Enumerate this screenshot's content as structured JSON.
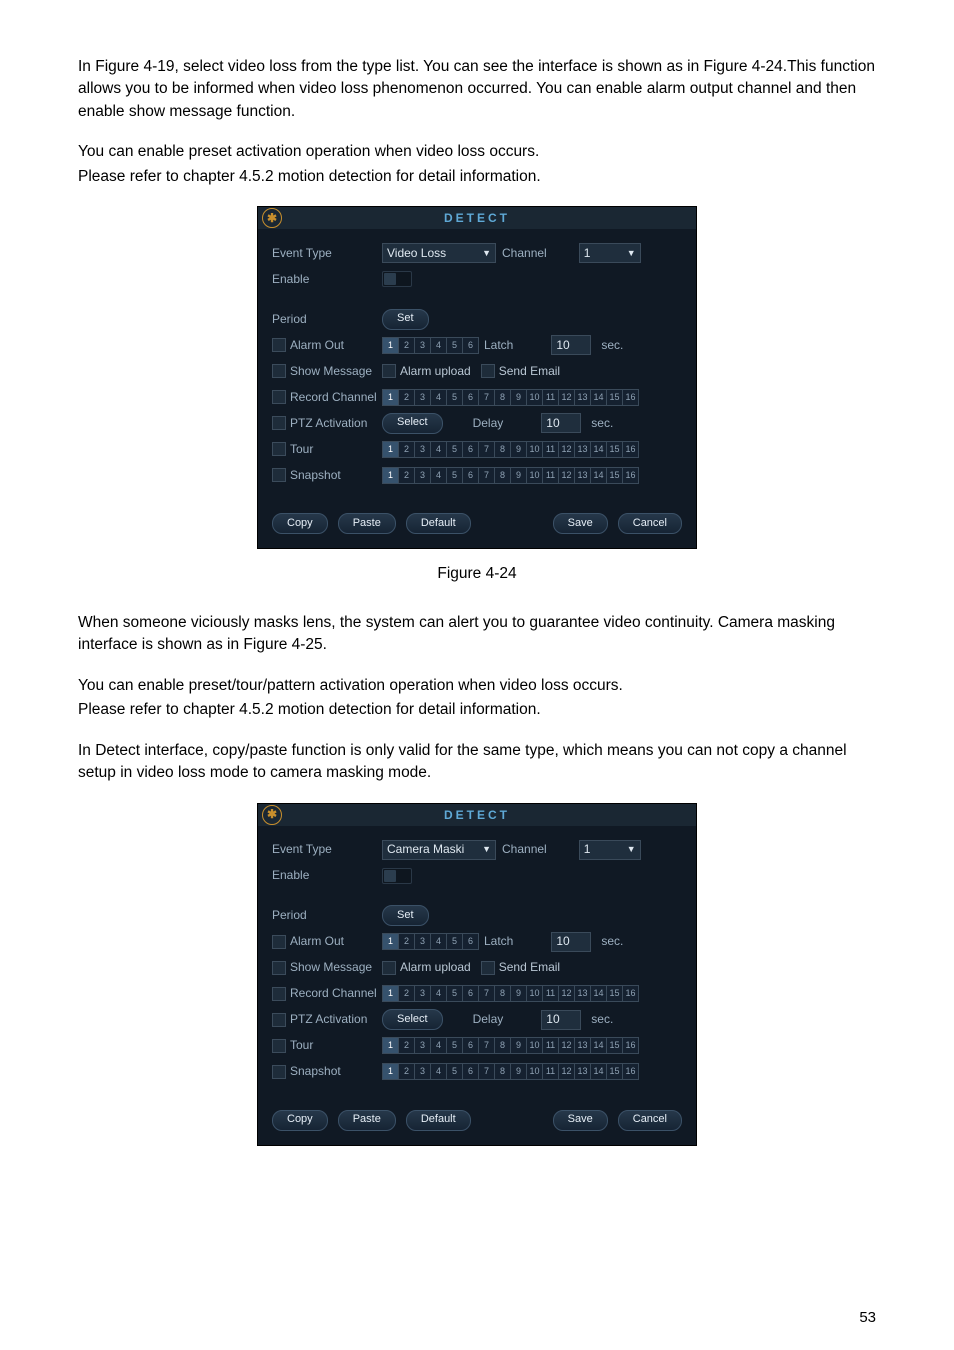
{
  "paragraphs": {
    "p1": "In Figure 4-19, select video loss from the type list. You can see the interface is shown as in Figure 4-24.This function allows you to be informed when video loss phenomenon occurred. You can enable alarm output channel and then enable show message function.",
    "p2a": "You can enable preset activation operation when video loss occurs.",
    "p2b": "Please refer to chapter 4.5.2 motion detection for detail information.",
    "p3": "When someone viciously masks lens, the system can alert you to guarantee video continuity. Camera masking interface is shown as in Figure 4-25.",
    "p4a": "You can enable preset/tour/pattern activation operation when video loss occurs.",
    "p4b": "Please refer to chapter 4.5.2 motion detection for detail information.",
    "p5": "In Detect interface, copy/paste function is only valid for the same type, which means you can not copy a channel setup in video loss mode to camera masking mode."
  },
  "caption1": "Figure 4-24",
  "page_number": "53",
  "detect_common": {
    "title": "DETECT",
    "labels": {
      "event_type": "Event Type",
      "enable": "Enable",
      "channel": "Channel",
      "period": "Period",
      "alarm_out": "Alarm Out",
      "show_message": "Show Message",
      "record_channel": "Record Channel",
      "ptz_activation": "PTZ Activation",
      "tour": "Tour",
      "snapshot": "Snapshot",
      "latch": "Latch",
      "delay": "Delay",
      "sec": "sec.",
      "alarm_upload": "Alarm upload",
      "send_email": "Send Email"
    },
    "buttons": {
      "set": "Set",
      "select": "Select",
      "copy": "Copy",
      "paste": "Paste",
      "default": "Default",
      "save": "Save",
      "cancel": "Cancel"
    },
    "channel_value": "1",
    "latch_value": "10",
    "delay_value": "10",
    "alarm_out_channels": [
      1,
      2,
      3,
      4,
      5,
      6
    ],
    "sixteen": [
      1,
      2,
      3,
      4,
      5,
      6,
      7,
      8,
      9,
      10,
      11,
      12,
      13,
      14,
      15,
      16
    ]
  },
  "panel1": {
    "event_type_value": "Video Loss"
  },
  "panel2": {
    "event_type_value": "Camera Maski"
  }
}
